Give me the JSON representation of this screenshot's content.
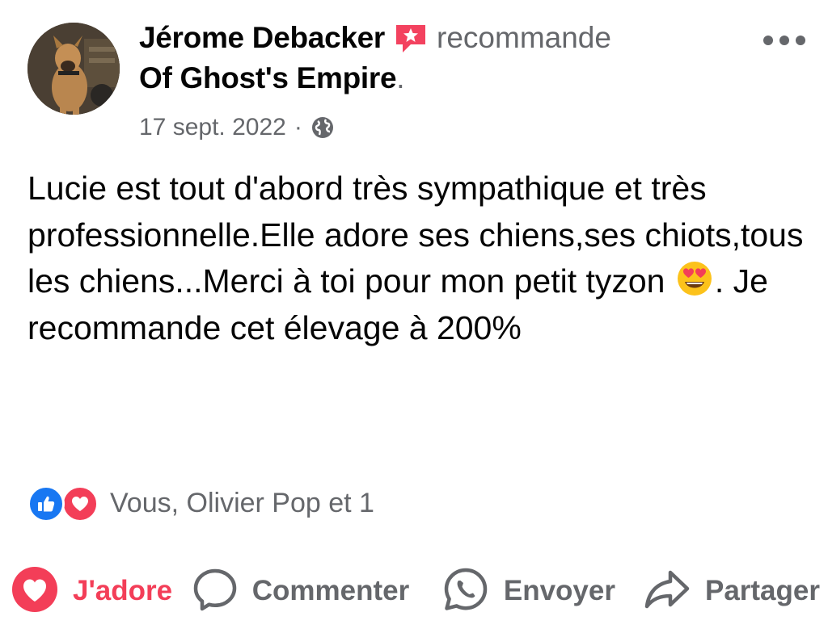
{
  "post": {
    "author": "Jérome Debacker",
    "recommends_word": "recommande",
    "page_name": "Of Ghost's Empire",
    "page_suffix": ".",
    "date": "17 sept. 2022",
    "meta_separator": "·",
    "audience_icon": "globe-icon",
    "more_icon": "more-options-icon",
    "text_before_emoji": "Lucie est tout d'abord très sympathique et très professionnelle.Elle adore ses chiens,ses chiots,tous les chiens...Merci à toi pour mon petit tyzon ",
    "emoji": "heart-eyes-emoji-icon",
    "text_after_emoji": ". Je recommande cet élevage à 200%"
  },
  "reactions": {
    "icons": [
      "like-reaction-icon",
      "love-reaction-icon"
    ],
    "summary": "Vous, Olivier Pop et 1"
  },
  "actions": {
    "love_label": "J'adore",
    "comment_label": "Commenter",
    "send_label": "Envoyer",
    "share_label": "Partager"
  },
  "colors": {
    "love_accent": "#f33e58",
    "like_blue": "#1877f2",
    "secondary_text": "#65676b",
    "primary_text": "#050505",
    "recommend_badge": "#f3425f"
  }
}
